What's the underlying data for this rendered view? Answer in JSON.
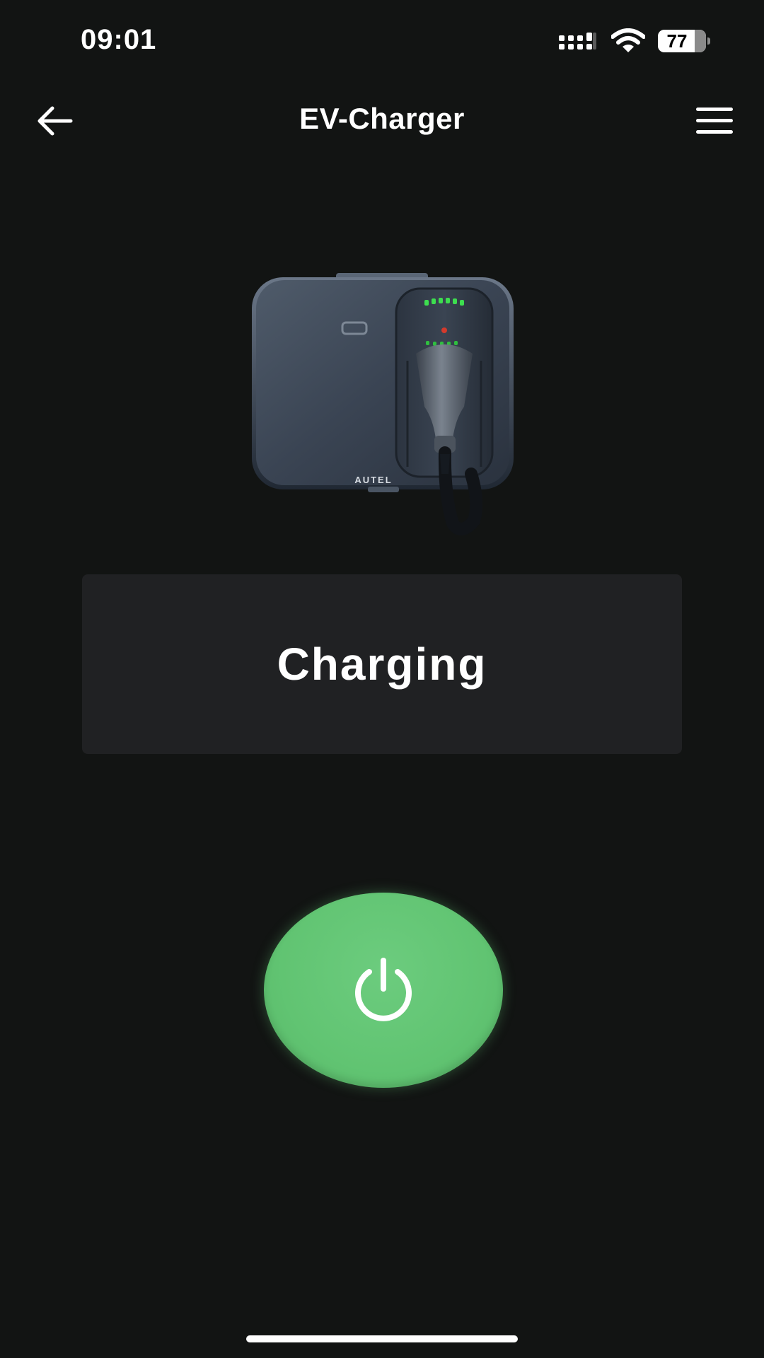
{
  "status_bar": {
    "time": "09:01",
    "battery_level": "77",
    "battery_fraction": 0.77,
    "icons": [
      "signal-icon",
      "wifi-icon",
      "battery-icon"
    ]
  },
  "header": {
    "title": "EV-Charger",
    "back_icon": "arrow-left-icon",
    "menu_icon": "hamburger-menu-icon"
  },
  "charger": {
    "brand_text": "AUTEL"
  },
  "status": {
    "label": "Charging"
  },
  "power_button": {
    "icon": "power-icon",
    "color": "#62c474"
  },
  "colors": {
    "background": "#121413",
    "card": "#202123",
    "accent_green": "#62c474",
    "indicator_green": "#3dde4f"
  }
}
